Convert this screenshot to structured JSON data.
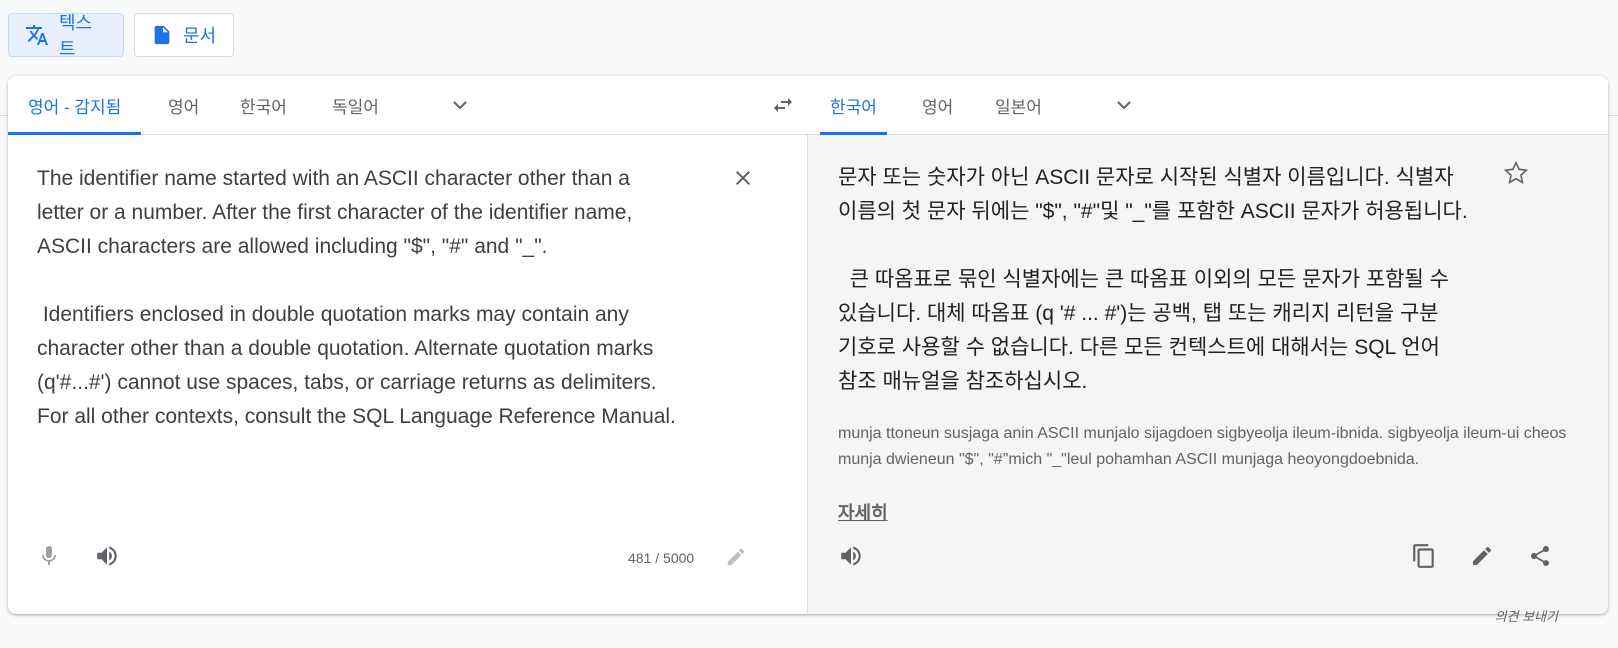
{
  "mode_buttons": {
    "text_label": "텍스트",
    "document_label": "문서"
  },
  "source_langs": [
    "영어 - 감지됨",
    "영어",
    "한국어",
    "독일어"
  ],
  "target_langs": [
    "한국어",
    "영어",
    "일본어"
  ],
  "source": {
    "text": "The identifier name started with an ASCII character other than a\nletter or a number. After the first character of the identifier name,\nASCII characters are allowed including \"$\", \"#\" and \"_\".\n\n Identifiers enclosed in double quotation marks may contain any\ncharacter other than a double quotation. Alternate quotation marks\n(q'#...#') cannot use spaces, tabs, or carriage returns as delimiters.\nFor all other contexts, consult the SQL Language Reference Manual.",
    "char_count": "481 / 5000"
  },
  "target": {
    "text": "문자 또는 숫자가 아닌 ASCII 문자로 시작된 식별자 이름입니다. 식별자\n이름의 첫 문자 뒤에는 \"$\", \"#\"및 \"_\"를 포함한 ASCII 문자가 허용됩니다.\n\n  큰 따옴표로 묶인 식별자에는 큰 따옴표 이외의 모든 문자가 포함될 수\n있습니다. 대체 따옴표 (q '# ... #')는 공백, 탭 또는 캐리지 리턴을 구분\n기호로 사용할 수 없습니다. 다른 모든 컨텍스트에 대해서는 SQL 언어\n참조 매뉴얼을 참조하십시오.",
    "romanization": "munja ttoneun susjaga anin ASCII munjalo sijagdoen sigbyeolja ileum-ibnida. sigbyeolja ileum-ui cheos munja dwieneun \"$\", \"#\"mich \"_\"leul pohamhan ASCII munjaga heoyongdoebnida.",
    "more_label": "자세히"
  },
  "feedback_label": "의견 보내기",
  "colors": {
    "accent": "#1a73e8",
    "muted": "#5f6368",
    "right_bg": "#f5f5f5"
  }
}
